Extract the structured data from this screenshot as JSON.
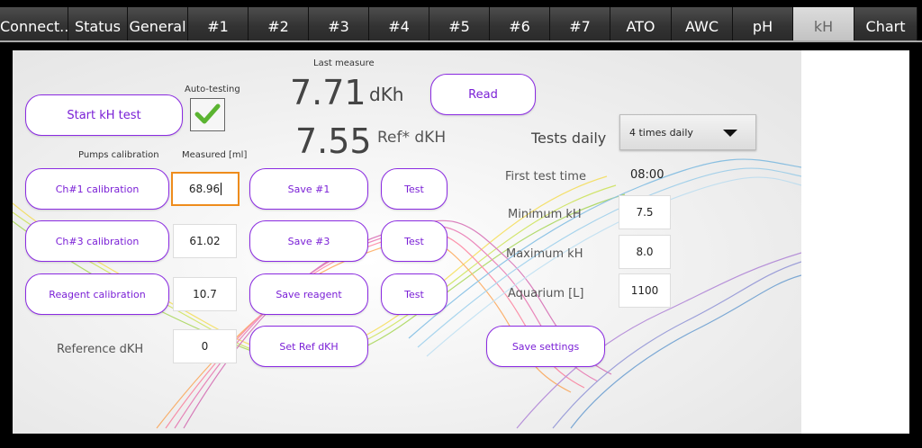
{
  "tabs": [
    "Connect..",
    "Status",
    "General",
    "#1",
    "#2",
    "#3",
    "#4",
    "#5",
    "#6",
    "#7",
    "ATO",
    "AWC",
    "pH",
    "kH",
    "Chart"
  ],
  "active_tab": "kH",
  "kh": {
    "start_button": "Start kH test",
    "auto_testing_label": "Auto-testing",
    "last_measure_label": "Last measure",
    "last_value": "7.71",
    "last_unit": "dKh",
    "read_button": "Read",
    "ref_value": "7.55",
    "ref_unit": "Ref* dKH",
    "pumps_calibration_label": "Pumps calibration",
    "measured_label": "Measured [ml]",
    "rows": [
      {
        "cal_button": "Ch#1 calibration",
        "value": "68.96",
        "save_button": "Save #1",
        "test_button": "Test"
      },
      {
        "cal_button": "Ch#3 calibration",
        "value": "61.02",
        "save_button": "Save #3",
        "test_button": "Test"
      },
      {
        "cal_button": "Reagent calibration",
        "value": "10.7",
        "save_button": "Save reagent",
        "test_button": "Test"
      }
    ],
    "reference_label": "Reference dKH",
    "reference_value": "0",
    "set_ref_button": "Set Ref dKH",
    "tests_daily_label": "Tests daily",
    "tests_daily_value": "4 times daily",
    "first_test_label": "First test time",
    "first_test_value": "08:00",
    "min_label": "Minimum kH",
    "min_value": "7.5",
    "max_label": "Maximum kH",
    "max_value": "8.0",
    "aquarium_label": "Aquarium [L]",
    "aquarium_value": "1100",
    "save_settings_button": "Save settings"
  }
}
